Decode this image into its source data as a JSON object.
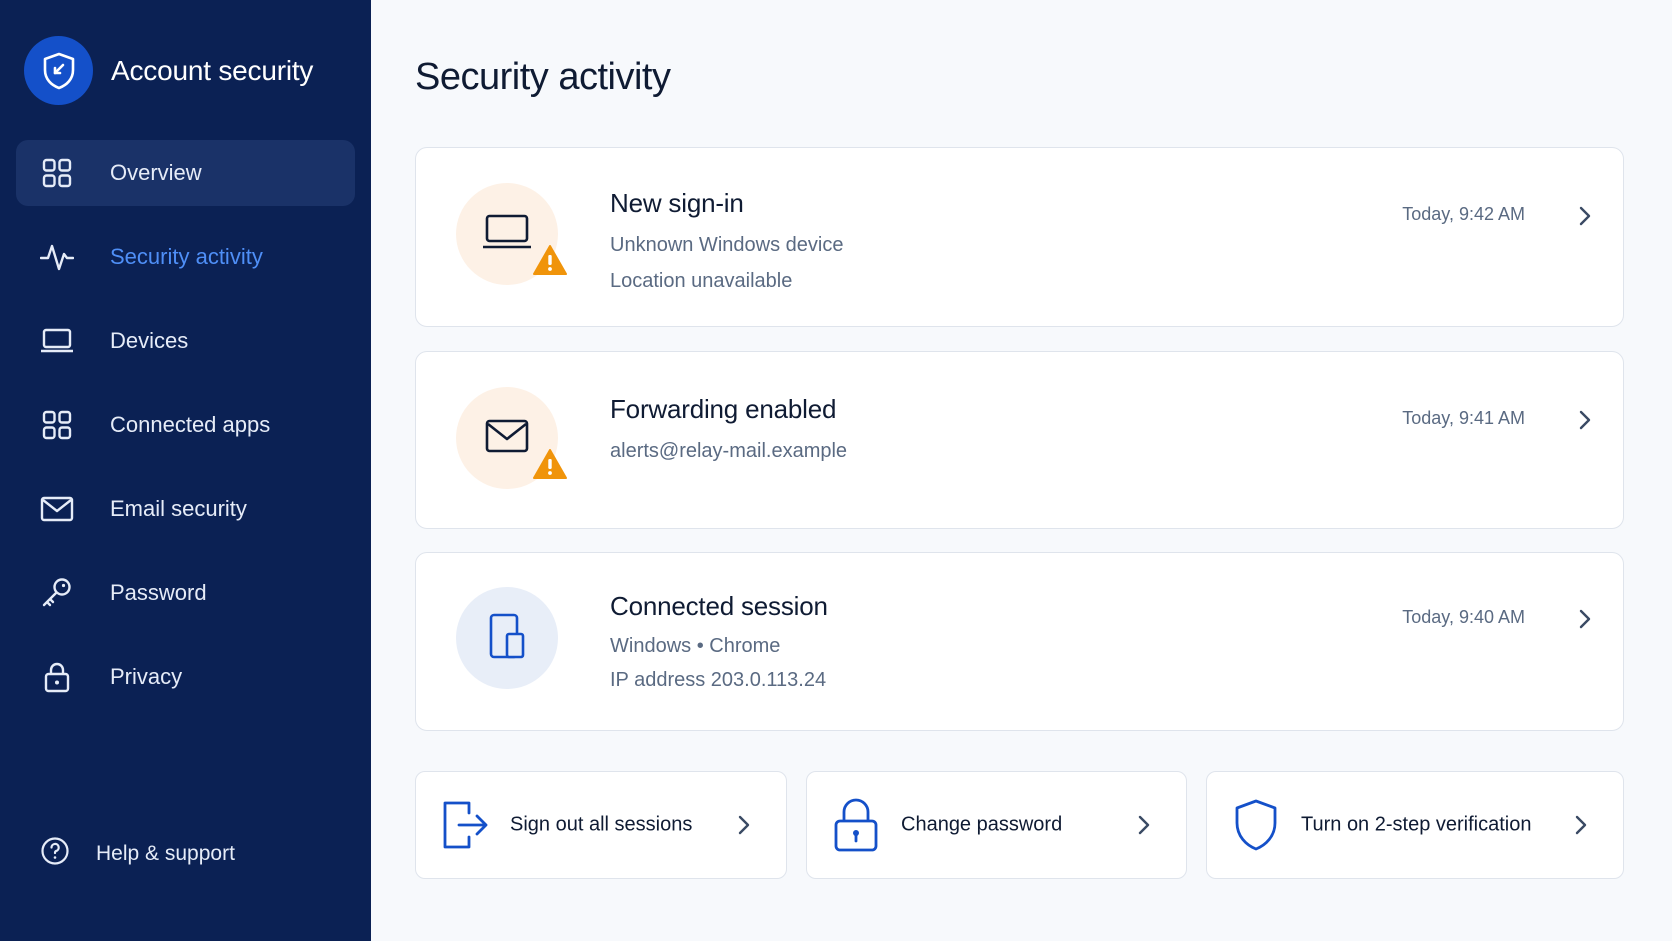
{
  "sidebar": {
    "app_title": "Account security",
    "items": [
      {
        "label": "Overview",
        "icon": "grid-icon"
      },
      {
        "label": "Security activity",
        "icon": "activity-icon"
      },
      {
        "label": "Devices",
        "icon": "laptop-icon"
      },
      {
        "label": "Connected apps",
        "icon": "grid-icon"
      },
      {
        "label": "Email security",
        "icon": "mail-icon"
      },
      {
        "label": "Password",
        "icon": "key-icon"
      },
      {
        "label": "Privacy",
        "icon": "lock-icon"
      }
    ],
    "help_label": "Help & support"
  },
  "main": {
    "title": "Security activity",
    "events": [
      {
        "title": "New sign-in",
        "lines": [
          "Unknown Windows device",
          "Location unavailable"
        ],
        "time": "Today, 9:42 AM",
        "icon": "laptop-icon",
        "severity": "warning"
      },
      {
        "title": "Forwarding enabled",
        "lines": [
          "alerts@relay-mail.example"
        ],
        "time": "Today, 9:41 AM",
        "icon": "mail-icon",
        "severity": "warning"
      },
      {
        "title": "Connected session",
        "lines": [
          "Windows • Chrome",
          "IP address 203.0.113.24"
        ],
        "time": "Today, 9:40 AM",
        "icon": "devices-icon",
        "severity": "info"
      }
    ],
    "actions": [
      {
        "label": "Sign out all sessions",
        "icon": "sign-out-icon"
      },
      {
        "label": "Change password",
        "icon": "lock-icon"
      },
      {
        "label": "Turn on 2-step verification",
        "icon": "shield-icon"
      }
    ]
  },
  "colors": {
    "sidebar_bg": "#0b2154",
    "sidebar_active_bg": "#1a3268",
    "accent": "#1450c9",
    "active_link": "#4f8ff7",
    "warning": "#f0940a",
    "warning_tint": "#fdf1e6",
    "info_tint": "#e8eef8",
    "page_bg": "#f7f9fc"
  }
}
